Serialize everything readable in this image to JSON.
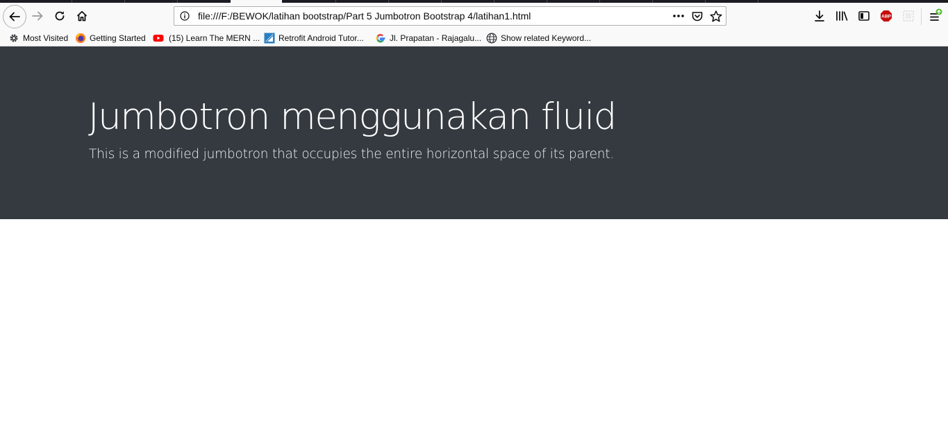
{
  "browser": {
    "url": "file:///F:/BEWOK/latihan bootstrap/Part 5 Jumbotron Bootstrap 4/latihan1.html",
    "bookmarks": [
      {
        "label": "Most Visited",
        "icon": "gear-icon"
      },
      {
        "label": "Getting Started",
        "icon": "firefox-icon"
      },
      {
        "label": "(15) Learn The MERN ...",
        "icon": "youtube-icon"
      },
      {
        "label": "Retrofit Android Tutor...",
        "icon": "site-icon"
      },
      {
        "label": "Jl. Prapatan - Rajagalu...",
        "icon": "google-icon"
      },
      {
        "label": "Show related Keyword...",
        "icon": "globe-icon"
      }
    ],
    "addon_badge": "ABP"
  },
  "jumbotron": {
    "title": "Jumbotron menggunakan fluid",
    "lead": "This is a modified jumbotron that occupies the entire horizontal space of its parent.",
    "background": "#343a40",
    "text_color": "#ffffff"
  }
}
